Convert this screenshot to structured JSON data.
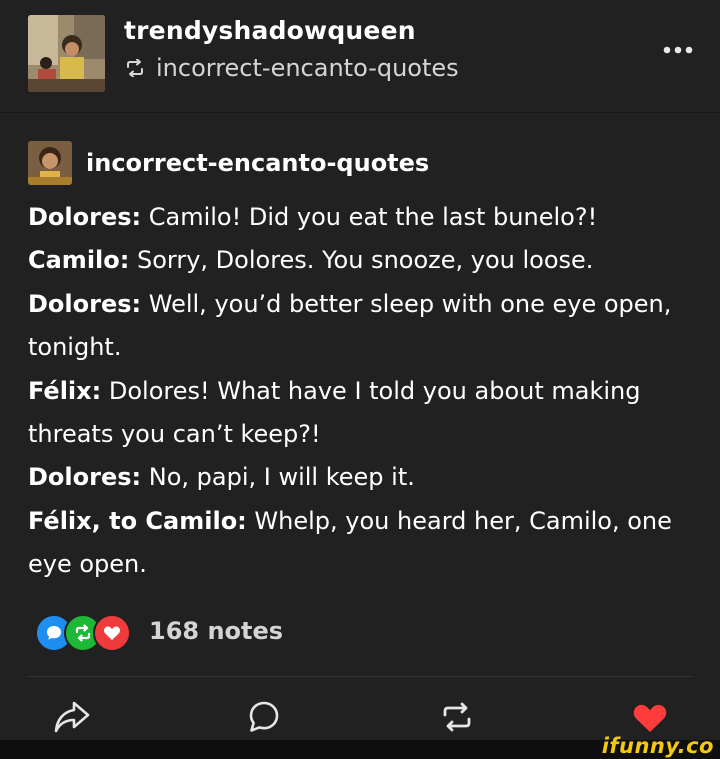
{
  "header": {
    "username": "trendyshadowqueen",
    "reblogged_from": "incorrect-encanto-quotes",
    "avatar_icon": "user-avatar-image",
    "reblog_icon": "reblog-icon",
    "more_icon": "more-options-icon"
  },
  "post": {
    "source_name": "incorrect-encanto-quotes",
    "source_avatar_icon": "blog-avatar-image",
    "lines": [
      {
        "speaker": "Dolores:",
        "text": " Camilo! Did you eat the last bunelo?!"
      },
      {
        "speaker": "Camilo:",
        "text": " Sorry, Dolores. You snooze, you loose."
      },
      {
        "speaker": "Dolores:",
        "text": " Well, you’d better sleep with one eye open,"
      },
      {
        "speaker": "",
        "text": "tonight."
      },
      {
        "speaker": "Félix:",
        "text": " Dolores! What have I told you about making"
      },
      {
        "speaker": "",
        "text": "threats you can’t keep?!"
      },
      {
        "speaker": "Dolores:",
        "text": " No, papi, I will keep it."
      },
      {
        "speaker": "Félix, to Camilo:",
        "text": " Whelp, you heard her, Camilo, one"
      },
      {
        "speaker": "",
        "text": "eye open."
      }
    ]
  },
  "notes": {
    "count_label": "168 notes",
    "icons": [
      "comment-bubble-icon",
      "reblog-bubble-icon",
      "like-bubble-icon"
    ]
  },
  "footer": {
    "actions": [
      "share-icon",
      "comment-icon",
      "reblog-icon",
      "like-icon"
    ]
  },
  "watermark": {
    "text": "ifunny.co"
  },
  "colors": {
    "background": "#212121",
    "blue": "#1e8ff0",
    "green": "#1db836",
    "red": "#ef3b3b",
    "watermark": "#f2c811"
  }
}
